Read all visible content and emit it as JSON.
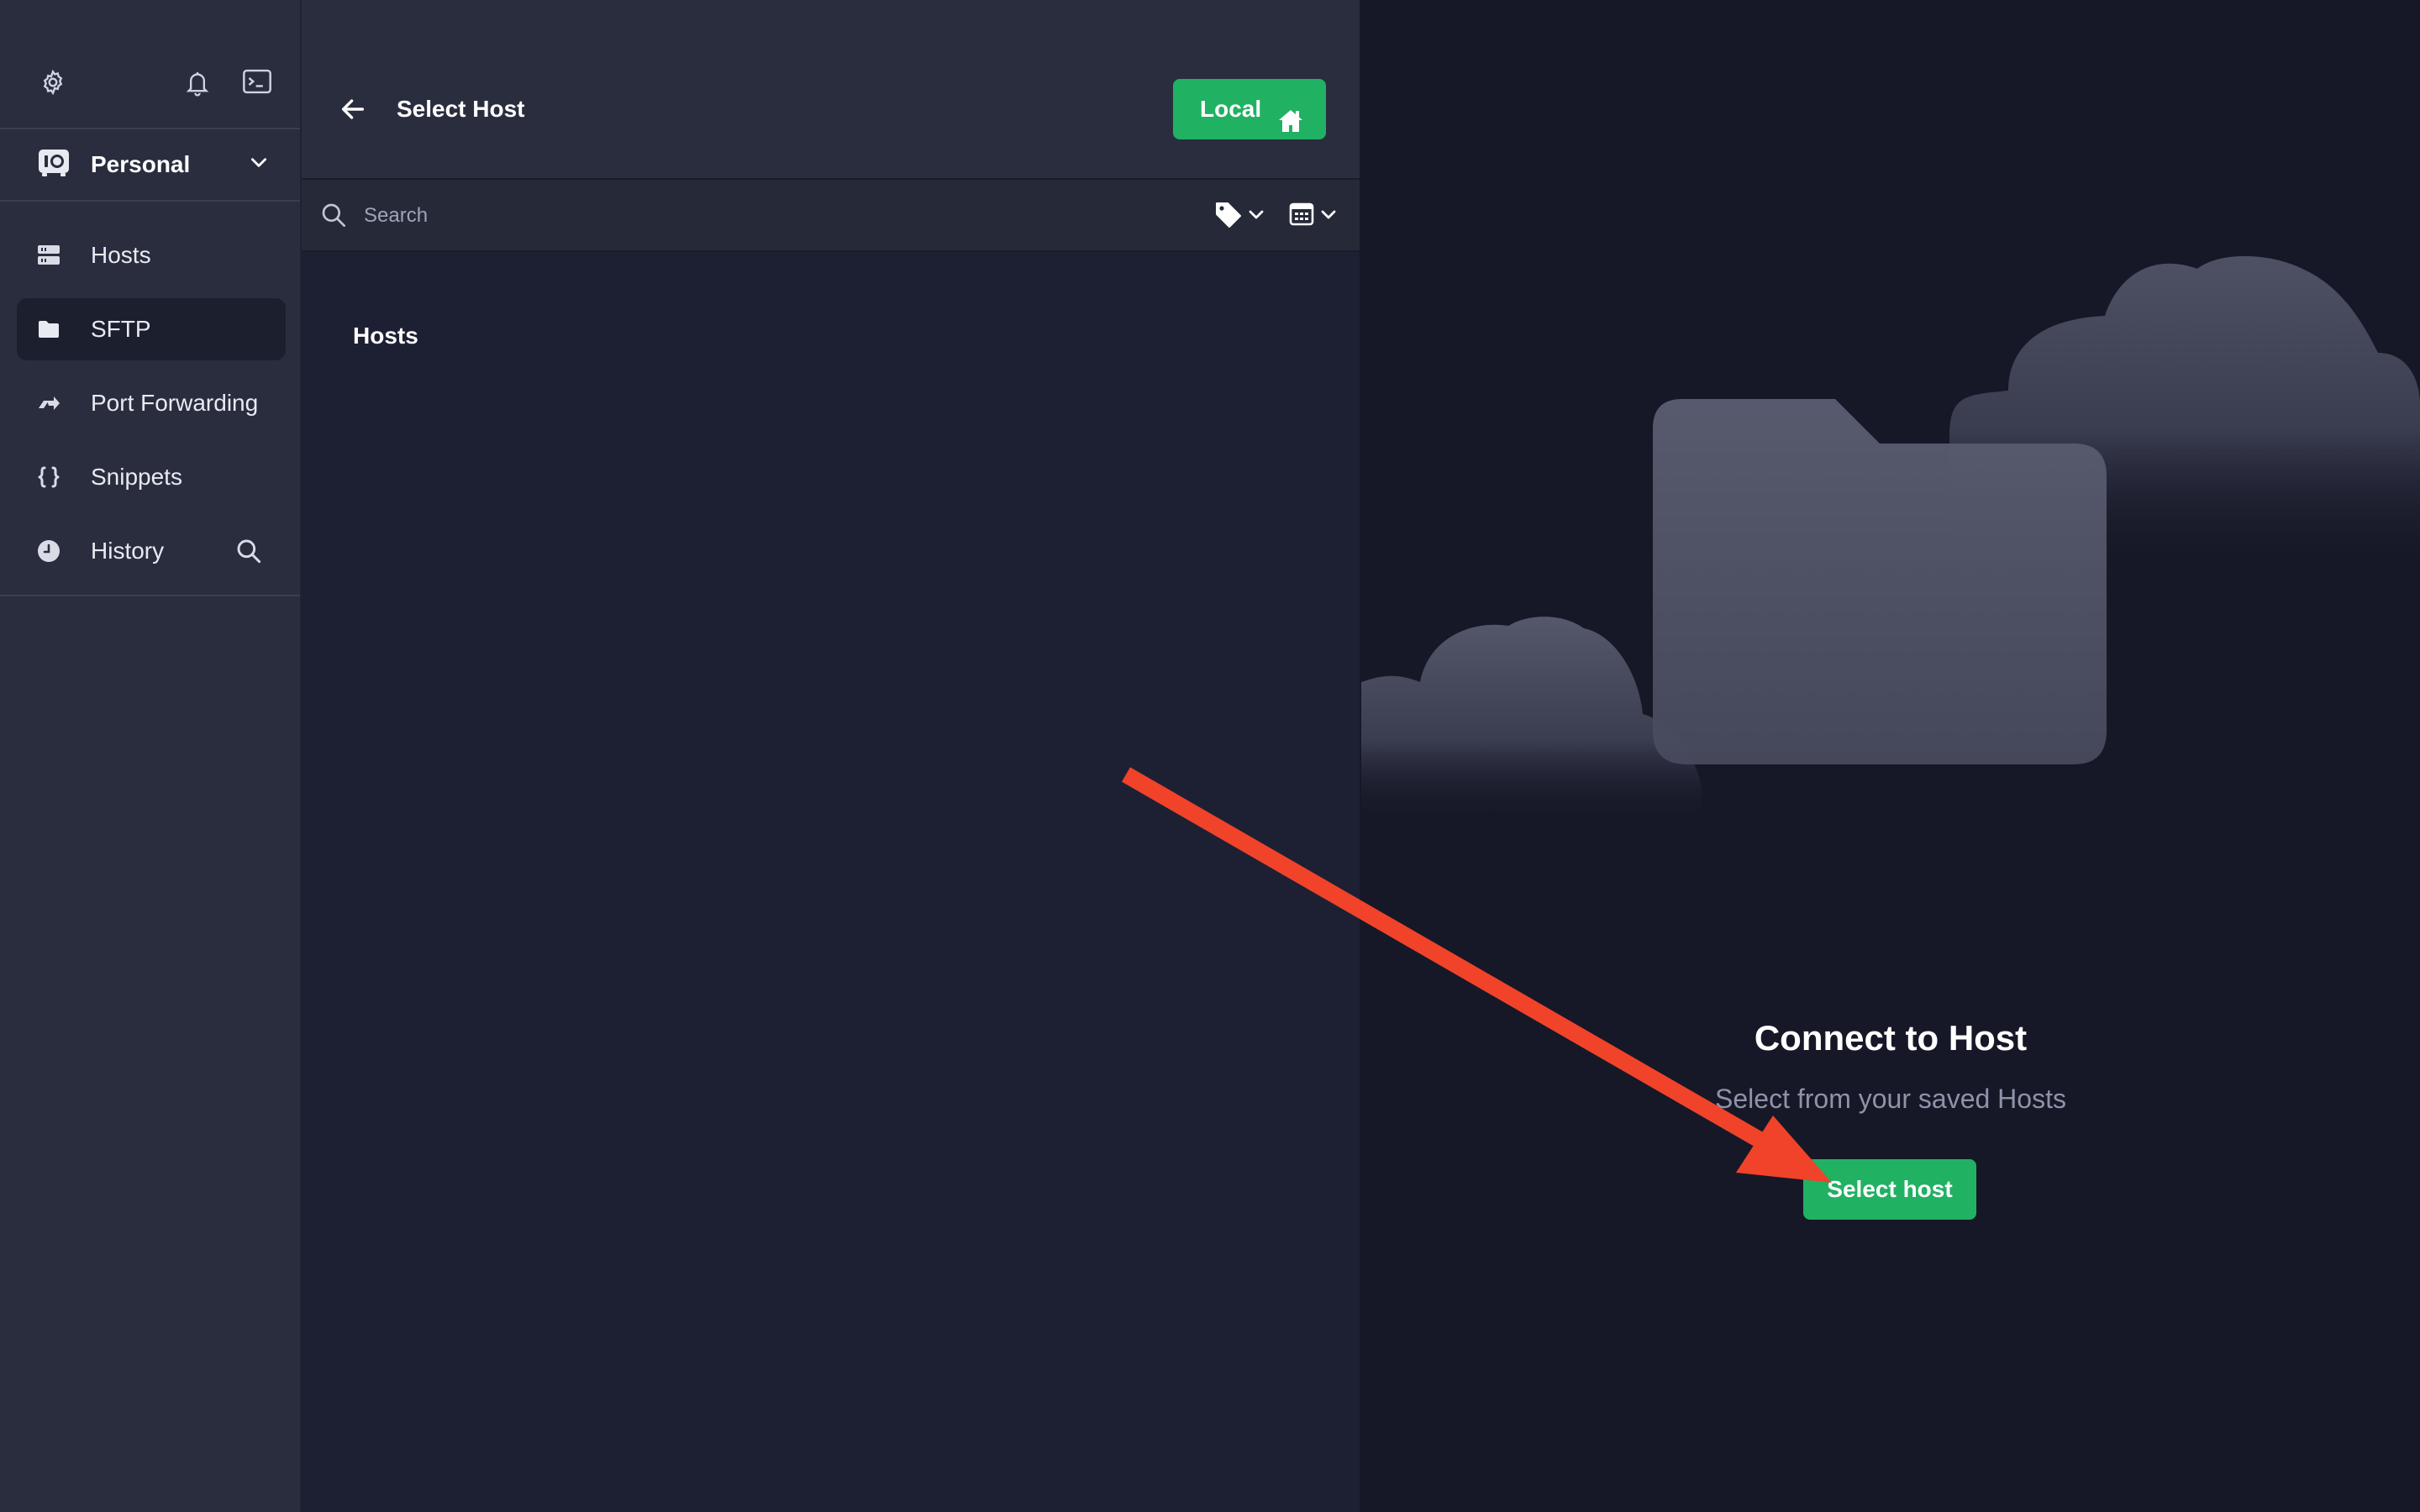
{
  "sidebar": {
    "top_icons": [
      "gear-icon",
      "bell-icon",
      "terminal-icon"
    ],
    "vault": {
      "label": "Personal",
      "icon": "vault-icon"
    },
    "items": [
      {
        "label": "Hosts",
        "icon": "hosts-icon",
        "active": false
      },
      {
        "label": "SFTP",
        "icon": "folder-icon",
        "active": true
      },
      {
        "label": "Port Forwarding",
        "icon": "port-forwarding-icon",
        "active": false
      },
      {
        "label": "Snippets",
        "icon": "braces-icon",
        "active": false
      },
      {
        "label": "History",
        "icon": "clock-icon",
        "active": false
      }
    ]
  },
  "middle": {
    "title": "Select Host",
    "local_button": "Local",
    "search_placeholder": "Search",
    "section_heading": "Hosts"
  },
  "right": {
    "title": "Connect to Host",
    "subtitle": "Select from your saved Hosts",
    "select_button": "Select host"
  },
  "colors": {
    "accent_green": "#21b163",
    "sidebar_bg": "#2a2d3e",
    "panel_bg": "#1d2033",
    "right_bg": "#161827",
    "annotation_arrow": "#f0432a"
  }
}
